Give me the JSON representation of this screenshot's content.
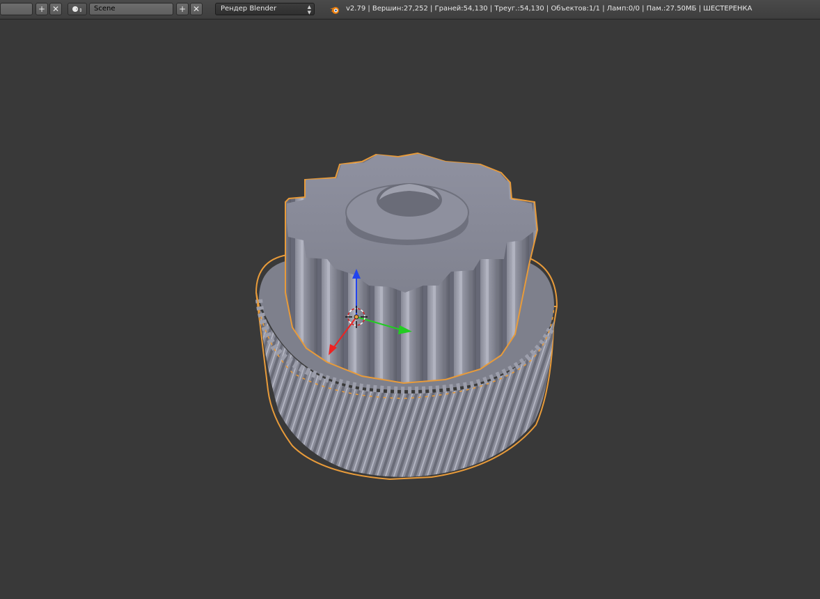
{
  "header": {
    "left_field_value": "",
    "scene_label": "Scene",
    "render_engine": "Рендер Blender",
    "stats_text": "v2.79 | Вершин:27,252 | Граней:54,130 | Треуг.:54,130 | Объектов:1/1 | Ламп:0/0 | Пам.:27.50МБ | ШЕСТЕРЕНКА",
    "add_icon": "plus-icon",
    "remove_icon": "close-icon"
  },
  "viewport": {
    "background_color": "#393939",
    "selection_outline_color": "#e89b3a",
    "object_color": "#8a8c99"
  }
}
